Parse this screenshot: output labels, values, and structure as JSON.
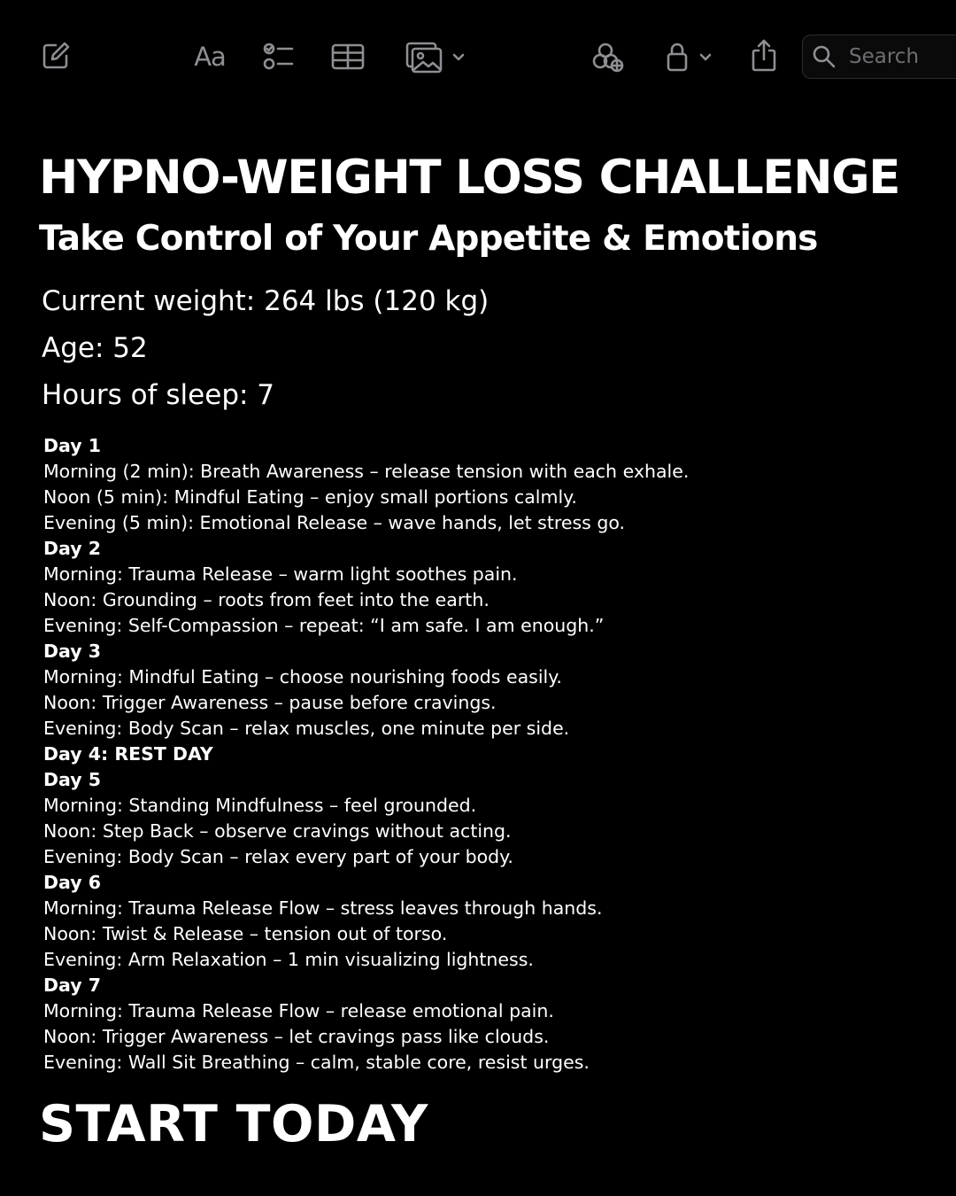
{
  "toolbar": {
    "items": [
      "compose-icon",
      "format-text-icon",
      "checklist-icon",
      "table-icon",
      "media-icon",
      "collaborate-icon",
      "lock-icon",
      "share-icon"
    ],
    "format_label": "Aa",
    "search_placeholder": "Search"
  },
  "note": {
    "title": "HYPNO-WEIGHT LOSS CHALLENGE",
    "subtitle": "Take Control of Your Appetite & Emotions",
    "stats": [
      "Current weight: 264 lbs (120 kg)",
      "Age: 52",
      "Hours of sleep: 7"
    ],
    "days": [
      {
        "title": "Day 1",
        "lines": [
          "Morning (2 min): Breath Awareness – release tension with each exhale.",
          "Noon (5 min): Mindful Eating – enjoy small portions calmly.",
          "Evening (5 min): Emotional Release – wave hands, let stress go."
        ]
      },
      {
        "title": "Day 2",
        "lines": [
          "Morning: Trauma Release – warm light soothes pain.",
          "Noon: Grounding – roots from feet into the earth.",
          "Evening: Self-Compassion – repeat: “I am safe. I am enough.”"
        ]
      },
      {
        "title": "Day 3",
        "lines": [
          "Morning: Mindful Eating – choose nourishing foods easily.",
          "Noon: Trigger Awareness – pause before cravings.",
          "Evening: Body Scan – relax muscles, one minute per side."
        ]
      },
      {
        "title": "Day 4: REST DAY",
        "lines": []
      },
      {
        "title": "Day 5",
        "lines": [
          "Morning: Standing Mindfulness – feel grounded.",
          "Noon: Step Back – observe cravings without acting.",
          "Evening: Body Scan – relax every part of your body."
        ]
      },
      {
        "title": "Day 6",
        "lines": [
          "Morning: Trauma Release Flow – stress leaves through hands.",
          "Noon: Twist & Release – tension out of torso.",
          "Evening: Arm Relaxation – 1 min visualizing lightness."
        ]
      },
      {
        "title": "Day 7",
        "lines": [
          "Morning: Trauma Release Flow – release emotional pain.",
          "Noon: Trigger Awareness – let cravings pass like clouds.",
          "Evening: Wall Sit Breathing – calm, stable core, resist urges."
        ]
      }
    ],
    "cta": "START TODAY"
  }
}
